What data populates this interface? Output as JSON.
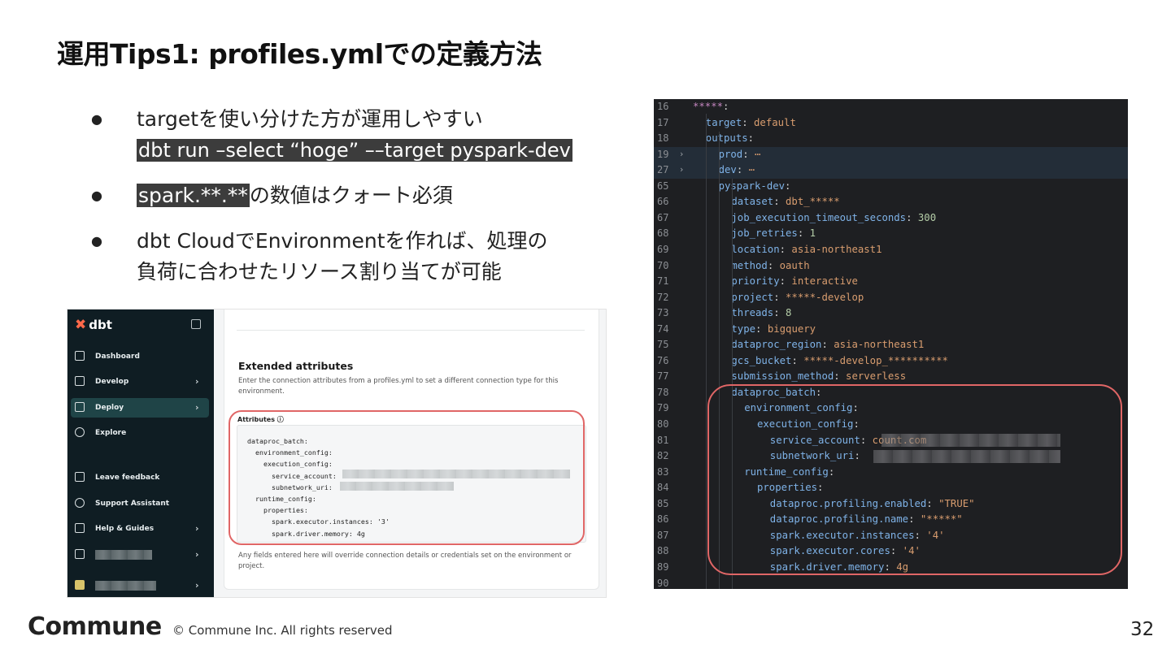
{
  "slide": {
    "title": "運用Tips1: profiles.ymlでの定義方法",
    "bullets": [
      {
        "text": "targetを使い分けた方が運用しやすい",
        "code": "dbt run –select “hoge” ––target pyspark-dev"
      },
      {
        "highlight": "spark.**.**",
        "text": "の数値はクォート必須"
      },
      {
        "line1": "dbt CloudでEnvironmentを作れば、処理の",
        "line2": "負荷に合わせたリソース割り当てが可能"
      }
    ],
    "footer_logo": "Commune",
    "footer_copyright": "© Commune Inc. All rights reserved",
    "page_number": "32"
  },
  "dbt": {
    "logo": "dbt",
    "nav": [
      {
        "label": "Dashboard"
      },
      {
        "label": "Develop"
      },
      {
        "label": "Deploy"
      },
      {
        "label": "Explore"
      },
      {
        "label": "Leave feedback"
      },
      {
        "label": "Support Assistant"
      },
      {
        "label": "Help & Guides"
      }
    ],
    "extended_title": "Extended attributes",
    "extended_desc": "Enter the connection attributes from a profiles.yml to set a different connection type for this environment.",
    "attributes_label": "Attributes ⓘ",
    "attributes_code": "dataproc_batch:\n  environment_config:\n    execution_config:\n      service_account:\n      subnetwork_uri:\n  runtime_config:\n    properties:\n      spark.executor.instances: '3'\n      spark.driver.memory: 4g",
    "footer_note": "Any fields entered here will override connection details or credentials set on the environment or project."
  },
  "editor": {
    "line_numbers": [
      "16",
      "17",
      "18",
      "19",
      "27",
      "65",
      "66",
      "67",
      "68",
      "69",
      "70",
      "71",
      "72",
      "73",
      "74",
      "75",
      "76",
      "77",
      "78",
      "79",
      "80",
      "81",
      "82",
      "83",
      "84",
      "85",
      "86",
      "87",
      "88",
      "89",
      "90"
    ],
    "lines": [
      {
        "key": "*****",
        "val": ""
      },
      {
        "key": "target",
        "val": "default"
      },
      {
        "key": "outputs",
        "val": ""
      },
      {
        "key": "prod",
        "val": "⋯"
      },
      {
        "key": "dev",
        "val": "⋯"
      },
      {
        "key": "pyspark-dev",
        "val": ""
      },
      {
        "key": "dataset",
        "val": "dbt_*****"
      },
      {
        "key": "job_execution_timeout_seconds",
        "val": "300"
      },
      {
        "key": "job_retries",
        "val": "1"
      },
      {
        "key": "location",
        "val": "asia-northeast1"
      },
      {
        "key": "method",
        "val": "oauth"
      },
      {
        "key": "priority",
        "val": "interactive"
      },
      {
        "key": "project",
        "val": "*****-develop"
      },
      {
        "key": "threads",
        "val": "8"
      },
      {
        "key": "type",
        "val": "bigquery"
      },
      {
        "key": "dataproc_region",
        "val": "asia-northeast1"
      },
      {
        "key": "gcs_bucket",
        "val": "*****-develop_**********"
      },
      {
        "key": "submission_method",
        "val": "serverless"
      },
      {
        "key": "dataproc_batch",
        "val": ""
      },
      {
        "key": "environment_config",
        "val": ""
      },
      {
        "key": "execution_config",
        "val": ""
      },
      {
        "key": "service_account",
        "val": "count.com"
      },
      {
        "key": "subnetwork_uri",
        "val": ""
      },
      {
        "key": "runtime_config",
        "val": ""
      },
      {
        "key": "properties",
        "val": ""
      },
      {
        "key": "dataproc.profiling.enabled",
        "val": "\"TRUE\""
      },
      {
        "key": "dataproc.profiling.name",
        "val": "\"*****\""
      },
      {
        "key": "spark.executor.instances",
        "val": "'4'"
      },
      {
        "key": "spark.executor.cores",
        "val": "'4'"
      },
      {
        "key": "spark.driver.memory",
        "val": "4g"
      },
      {
        "key": "",
        "val": ""
      }
    ]
  }
}
